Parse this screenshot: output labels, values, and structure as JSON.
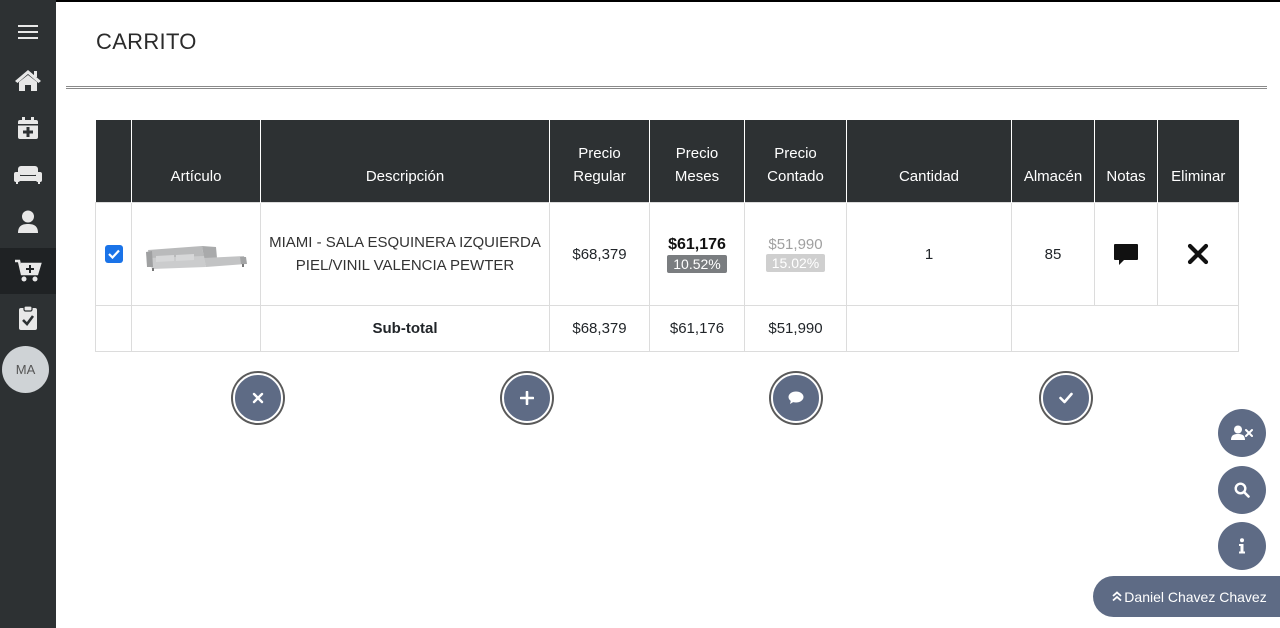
{
  "page": {
    "title": "CARRITO"
  },
  "sidebar": {
    "items": [
      {
        "name": "menu",
        "icon": "hamburger-icon"
      },
      {
        "name": "home",
        "icon": "home-icon"
      },
      {
        "name": "calendar",
        "icon": "calendar-plus-icon"
      },
      {
        "name": "sofa",
        "icon": "couch-icon"
      },
      {
        "name": "user",
        "icon": "user-icon"
      },
      {
        "name": "cart",
        "icon": "cart-icon",
        "active": true
      },
      {
        "name": "clipboard",
        "icon": "clipboard-check-icon"
      }
    ],
    "avatar": "MA"
  },
  "table": {
    "headers": {
      "select": "",
      "articulo": "Artículo",
      "descripcion": "Descripción",
      "precio_regular_1": "Precio",
      "precio_regular_2": "Regular",
      "precio_meses_1": "Precio",
      "precio_meses_2": "Meses",
      "precio_contado_1": "Precio",
      "precio_contado_2": "Contado",
      "cantidad": "Cantidad",
      "almacen": "Almacén",
      "notas": "Notas",
      "eliminar": "Eliminar"
    },
    "rows": [
      {
        "selected": true,
        "image": "sofa-image",
        "descripcion": "MIAMI - SALA ESQUINERA IZQUIERDA PIEL/VINIL VALENCIA PEWTER",
        "precio_regular": "$68,379",
        "precio_meses": "$61,176",
        "descuento_meses": "10.52%",
        "precio_contado": "$51,990",
        "descuento_contado": "15.02%",
        "cantidad": "1",
        "almacen": "85"
      }
    ],
    "subtotal": {
      "label": "Sub-total",
      "precio_regular": "$68,379",
      "precio_meses": "$61,176",
      "precio_contado": "$51,990"
    }
  },
  "actions": [
    {
      "name": "cancel",
      "icon": "times-icon"
    },
    {
      "name": "add",
      "icon": "plus-icon"
    },
    {
      "name": "comment",
      "icon": "comment-icon"
    },
    {
      "name": "confirm",
      "icon": "check-icon"
    }
  ],
  "floating": {
    "buttons": [
      {
        "name": "remove-user",
        "icon": "user-times-icon"
      },
      {
        "name": "search",
        "icon": "search-icon"
      },
      {
        "name": "info",
        "icon": "info-icon"
      }
    ],
    "user_label": "Daniel Chavez Chavez"
  },
  "colors": {
    "sidebar": "#2d3133",
    "header_bg": "#2d3133",
    "accent": "#5e6b85",
    "checkbox": "#1a73e8"
  }
}
